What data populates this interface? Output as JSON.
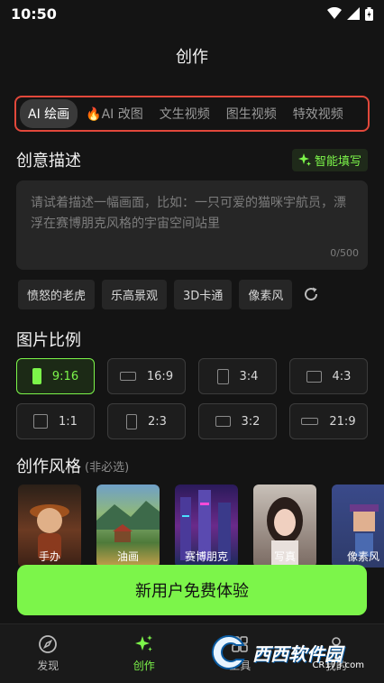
{
  "status": {
    "time": "10:50"
  },
  "header": {
    "title": "创作"
  },
  "tabs": [
    {
      "label": "AI 绘画",
      "active": true
    },
    {
      "label": "🔥AI 改图",
      "active": false
    },
    {
      "label": "文生视频",
      "active": false
    },
    {
      "label": "图生视频",
      "active": false
    },
    {
      "label": "特效视频",
      "active": false
    }
  ],
  "prompt": {
    "title": "创意描述",
    "smart_fill": "智能填写",
    "placeholder": "请试着描述一幅画面，比如：一只可爱的猫咪宇航员，漂浮在赛博朋克风格的宇宙空间站里",
    "counter": "0/500"
  },
  "chips": [
    "愤怒的老虎",
    "乐高景观",
    "3D卡通",
    "像素风"
  ],
  "ratio": {
    "title": "图片比例",
    "options": [
      {
        "label": "9:16",
        "active": true
      },
      {
        "label": "16:9",
        "active": false
      },
      {
        "label": "3:4",
        "active": false
      },
      {
        "label": "4:3",
        "active": false
      },
      {
        "label": "1:1",
        "active": false
      },
      {
        "label": "2:3",
        "active": false
      },
      {
        "label": "3:2",
        "active": false
      },
      {
        "label": "21:9",
        "active": false
      }
    ]
  },
  "styles": {
    "title": "创作风格",
    "subtitle": "(非必选)",
    "items": [
      {
        "label": "手办",
        "color": "#6b3a22"
      },
      {
        "label": "油画",
        "color": "#4e7a3a"
      },
      {
        "label": "赛博朋克",
        "color": "#3b2a6b"
      },
      {
        "label": "写真",
        "color": "#7a6a62"
      },
      {
        "label": "像素风",
        "color": "#2e3b6a"
      }
    ]
  },
  "cta": {
    "label": "新用户免费体验"
  },
  "nav": [
    {
      "label": "发现",
      "icon": "compass-icon",
      "active": false
    },
    {
      "label": "创作",
      "icon": "sparkle-icon",
      "active": true
    },
    {
      "label": "工具",
      "icon": "tool-icon",
      "active": false
    },
    {
      "label": "我的",
      "icon": "user-icon",
      "active": false
    }
  ],
  "watermark": {
    "brand": "西西软件园",
    "domain": "CR173.com"
  },
  "colors": {
    "accent": "#7cf54a",
    "tab_highlight_border": "#e2483b",
    "background": "#141414"
  }
}
